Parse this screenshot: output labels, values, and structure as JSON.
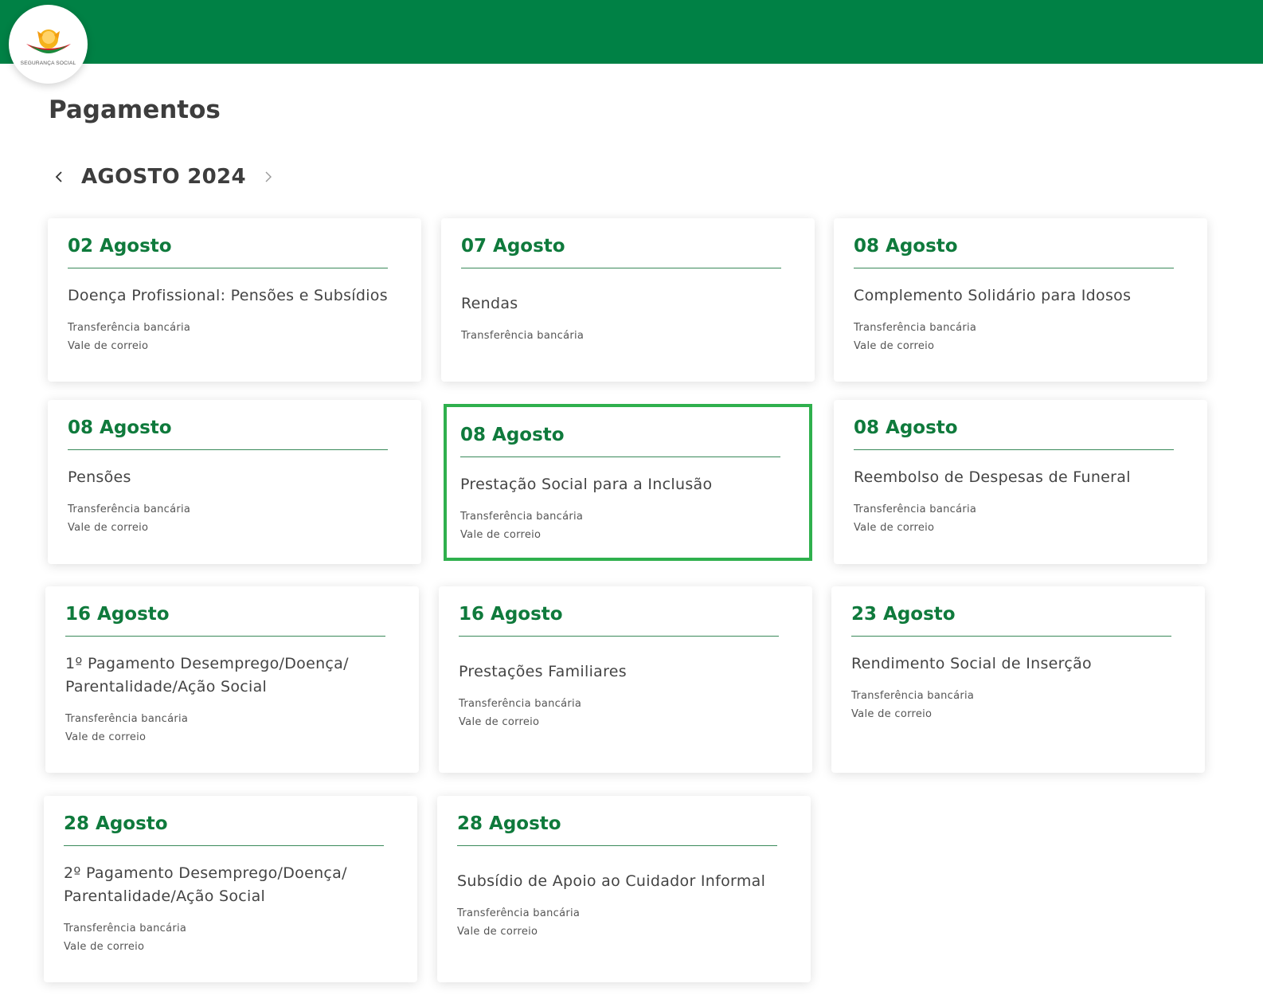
{
  "header": {
    "logo_text": "SEGURANÇA SOCIAL",
    "brand_color": "#008145",
    "logo_icon": "seguranca-social-logo"
  },
  "page": {
    "title": "Pagamentos"
  },
  "month_nav": {
    "label": "AGOSTO 2024",
    "prev_icon": "chevron-left-icon",
    "next_icon": "chevron-right-icon"
  },
  "payments": [
    {
      "date": "02 Agosto",
      "title": "Doença Profissional: Pensões e Subsídios",
      "methods": [
        "Transferência bancária",
        "Vale de correio"
      ]
    },
    {
      "date": "07 Agosto",
      "title": "Rendas",
      "methods": [
        "Transferência bancária"
      ]
    },
    {
      "date": "08 Agosto",
      "title": "Complemento Solidário para Idosos",
      "methods": [
        "Transferência bancária",
        "Vale de correio"
      ]
    },
    {
      "date": "08 Agosto",
      "title": "Pensões",
      "methods": [
        "Transferência bancária",
        "Vale de correio"
      ]
    },
    {
      "date": "08 Agosto",
      "title": "Prestação Social para a Inclusão",
      "methods": [
        "Transferência bancária",
        "Vale de correio"
      ],
      "selected": true
    },
    {
      "date": "08 Agosto",
      "title": "Reembolso de Despesas de Funeral",
      "methods": [
        "Transferência bancária",
        "Vale de correio"
      ]
    },
    {
      "date": "16 Agosto",
      "title": "1º Pagamento Desemprego/Doença/\nParentalidade/Ação Social",
      "methods": [
        "Transferência bancária",
        "Vale de correio"
      ]
    },
    {
      "date": "16 Agosto",
      "title": "Prestações Familiares",
      "methods": [
        "Transferência bancária",
        "Vale de correio"
      ]
    },
    {
      "date": "23 Agosto",
      "title": "Rendimento Social de Inserção",
      "methods": [
        "Transferência bancária",
        "Vale de correio"
      ]
    },
    {
      "date": "28 Agosto",
      "title": "2º Pagamento Desemprego/Doença/\nParentalidade/Ação Social",
      "methods": [
        "Transferência bancária",
        "Vale de correio"
      ]
    },
    {
      "date": "28 Agosto",
      "title": "Subsídio de Apoio ao Cuidador Informal",
      "methods": [
        "Transferência bancária",
        "Vale de correio"
      ]
    }
  ],
  "colors": {
    "accent_green": "#0f7a3c",
    "selected_border": "#2fb04d"
  }
}
